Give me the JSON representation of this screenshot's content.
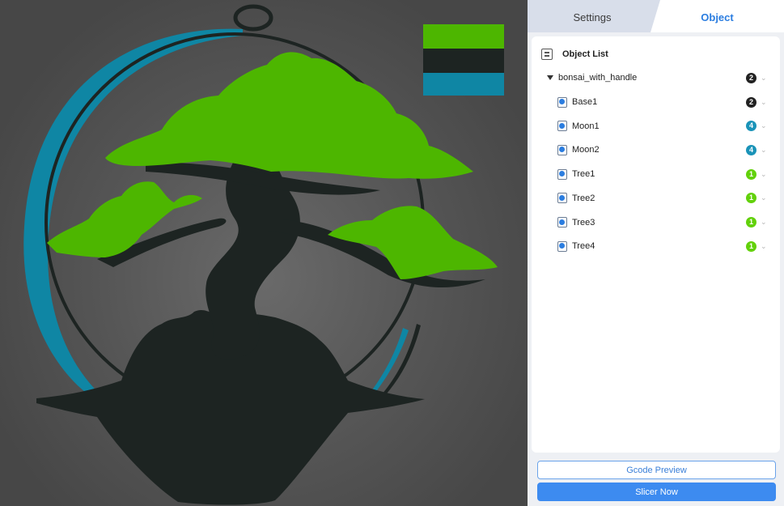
{
  "tabs": [
    {
      "label": "Settings",
      "active": false
    },
    {
      "label": "Object",
      "active": true
    }
  ],
  "object_list": {
    "title": "Object List",
    "title_icon": "list-icon",
    "root": {
      "label": "bonsai_with_handle",
      "badge": "2",
      "badge_color": "#222222"
    },
    "children": [
      {
        "label": "Base1",
        "badge": "2",
        "badge_color": "#222222"
      },
      {
        "label": "Moon1",
        "badge": "4",
        "badge_color": "#1a93b8"
      },
      {
        "label": "Moon2",
        "badge": "4",
        "badge_color": "#1a93b8"
      },
      {
        "label": "Tree1",
        "badge": "1",
        "badge_color": "#62d10a"
      },
      {
        "label": "Tree2",
        "badge": "1",
        "badge_color": "#62d10a"
      },
      {
        "label": "Tree3",
        "badge": "1",
        "badge_color": "#62d10a"
      },
      {
        "label": "Tree4",
        "badge": "1",
        "badge_color": "#62d10a"
      }
    ]
  },
  "buttons": {
    "gcode_preview": "Gcode Preview",
    "slicer_now": "Slicer Now"
  },
  "colors": {
    "filament_green": "#4db600",
    "filament_black": "#1d2422",
    "filament_teal": "#0f86a4",
    "accent": "#3d8bf0"
  }
}
